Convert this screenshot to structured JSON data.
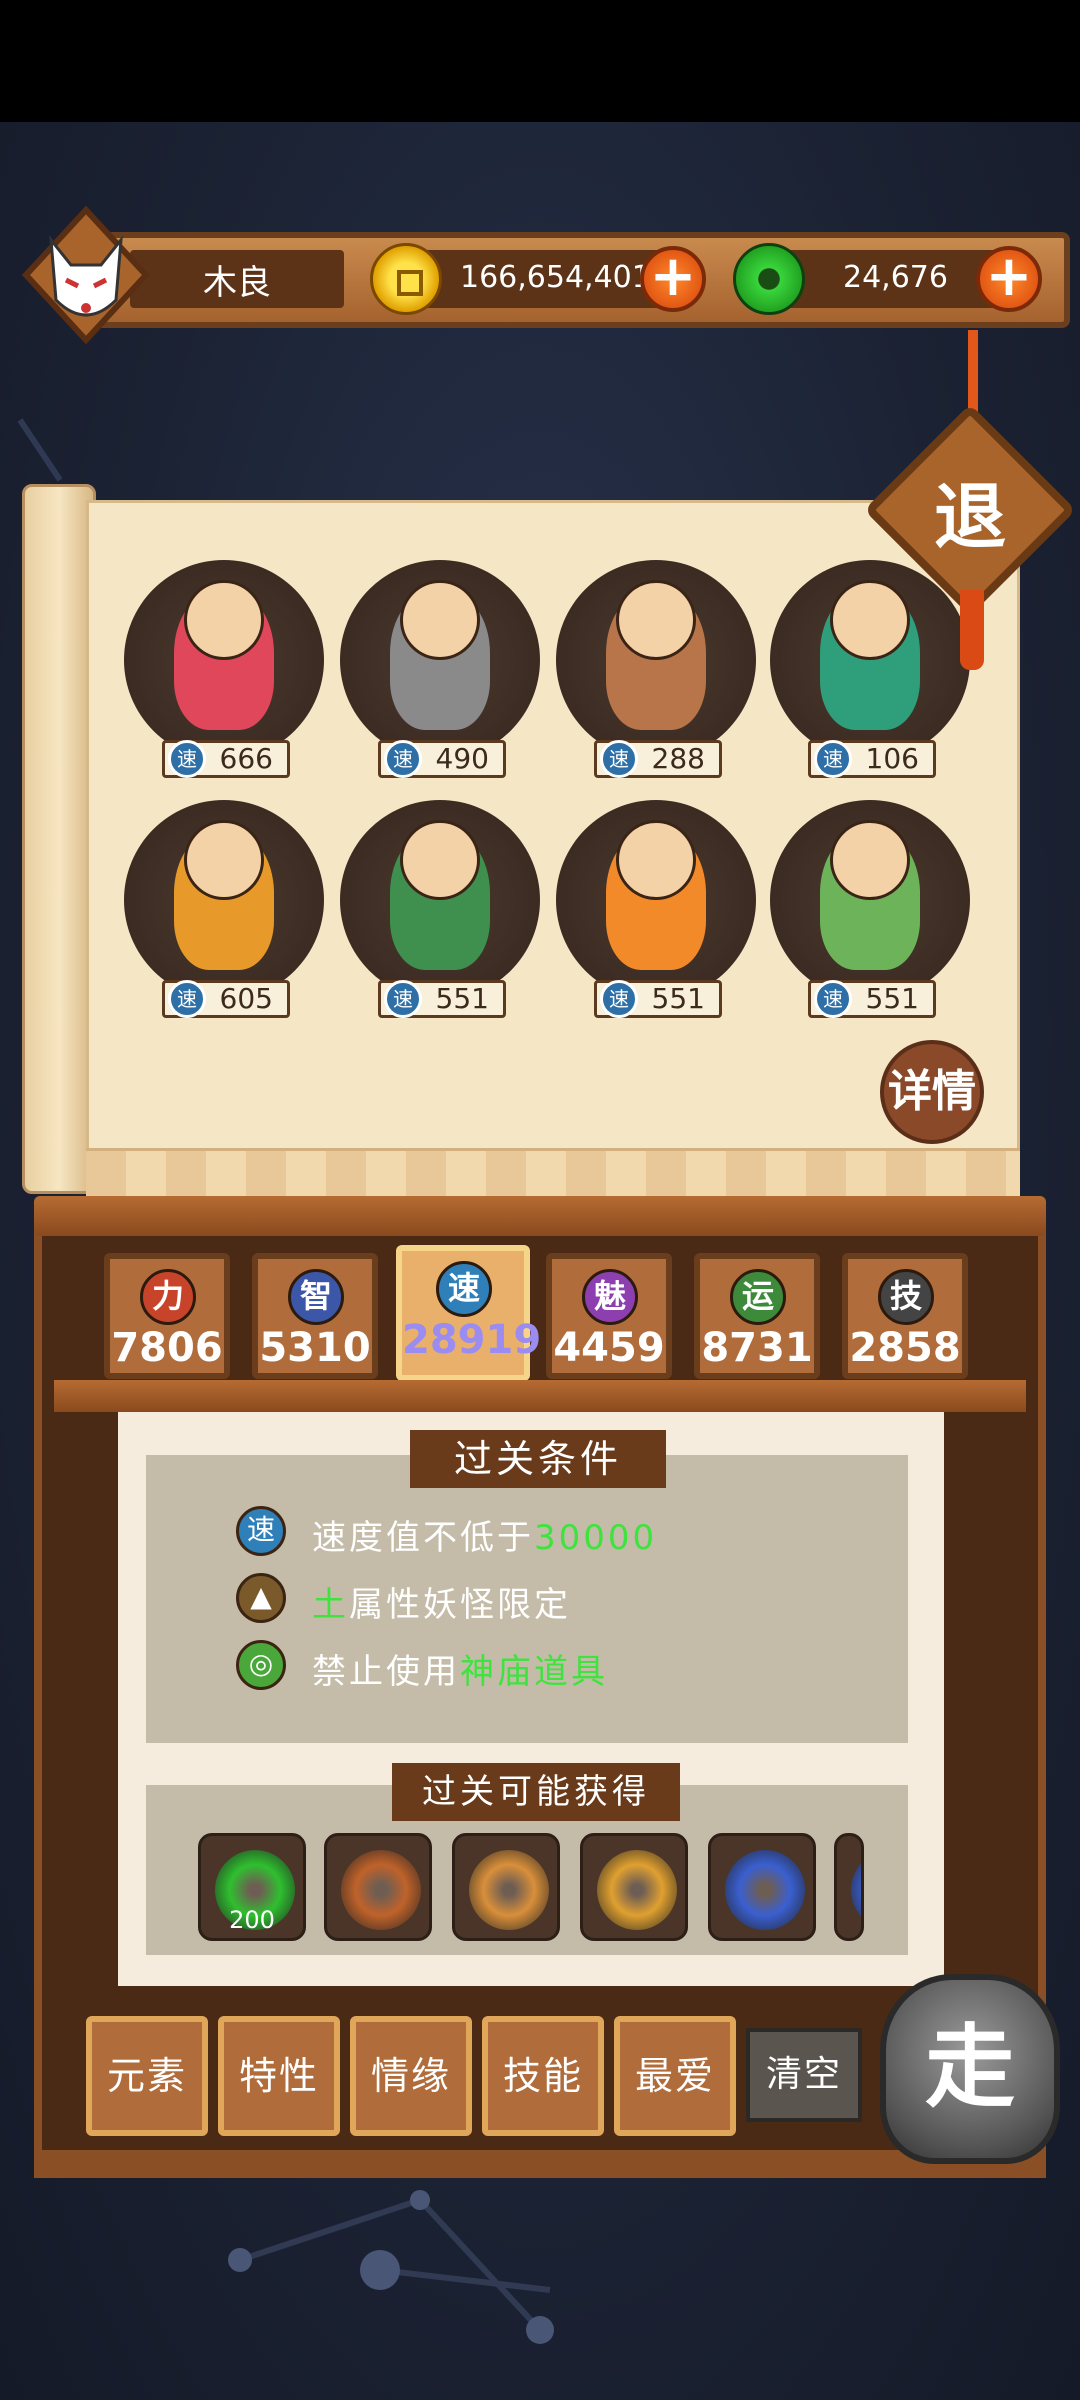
{
  "player": {
    "name": "木良"
  },
  "currency": {
    "gold": "166,654,401",
    "jade": "24,676",
    "plus_label": "+"
  },
  "exit_label": "退",
  "detail_label": "详情",
  "monsters": [
    {
      "speed": "666",
      "color": "#e0475b"
    },
    {
      "speed": "490",
      "color": "#8a8a8a"
    },
    {
      "speed": "288",
      "color": "#b8754a"
    },
    {
      "speed": "106",
      "color": "#2f9e7a"
    },
    {
      "speed": "605",
      "color": "#e79a2a"
    },
    {
      "speed": "551",
      "color": "#3f8f4f"
    },
    {
      "speed": "551",
      "color": "#f28a2a"
    },
    {
      "speed": "551",
      "color": "#6db35a"
    }
  ],
  "speed_icon": "速",
  "stats": [
    {
      "icon": "力",
      "value": "7806",
      "color": "#c7432a"
    },
    {
      "icon": "智",
      "value": "5310",
      "color": "#3c57a8"
    },
    {
      "icon": "速",
      "value": "28919",
      "color": "#2f7fb9"
    },
    {
      "icon": "魅",
      "value": "4459",
      "color": "#8d3fb0"
    },
    {
      "icon": "运",
      "value": "8731",
      "color": "#3d8a3a"
    },
    {
      "icon": "技",
      "value": "2858",
      "color": "#444444"
    }
  ],
  "conditions": {
    "title": "过关条件",
    "rows": [
      {
        "icon": "速",
        "pre": "速度值不低于",
        "hl": "30000",
        "post": ""
      },
      {
        "icon": "▲",
        "pre": "",
        "hl": "土",
        "post": "属性妖怪限定"
      },
      {
        "icon": "◎",
        "pre": "禁止使用",
        "hl": "神庙道具",
        "post": ""
      }
    ]
  },
  "rewards": {
    "title": "过关可能获得",
    "items": [
      {
        "icon": "jade-coin-icon",
        "count": "200",
        "color": "#2fbf2f"
      },
      {
        "icon": "earth-rune-icon",
        "count": "",
        "color": "#c0622a"
      },
      {
        "icon": "amber-gem-icon",
        "count": "",
        "color": "#d98f3a"
      },
      {
        "icon": "mountain-crystal-icon",
        "count": "",
        "color": "#e0a030"
      },
      {
        "icon": "blue-crystal-icon",
        "count": "",
        "color": "#3a5fd0"
      },
      {
        "icon": "blue-crystal-icon",
        "count": "",
        "color": "#3a5fd0"
      }
    ]
  },
  "tabs": [
    "元素",
    "特性",
    "情缘",
    "技能",
    "最爱"
  ],
  "clear_label": "清空",
  "go_label": "走",
  "colors": {
    "gold": "#ffd23a",
    "jade": "#2fbf2f",
    "highlight": "#3ee33e",
    "active_stat": "#9a8cf0"
  }
}
